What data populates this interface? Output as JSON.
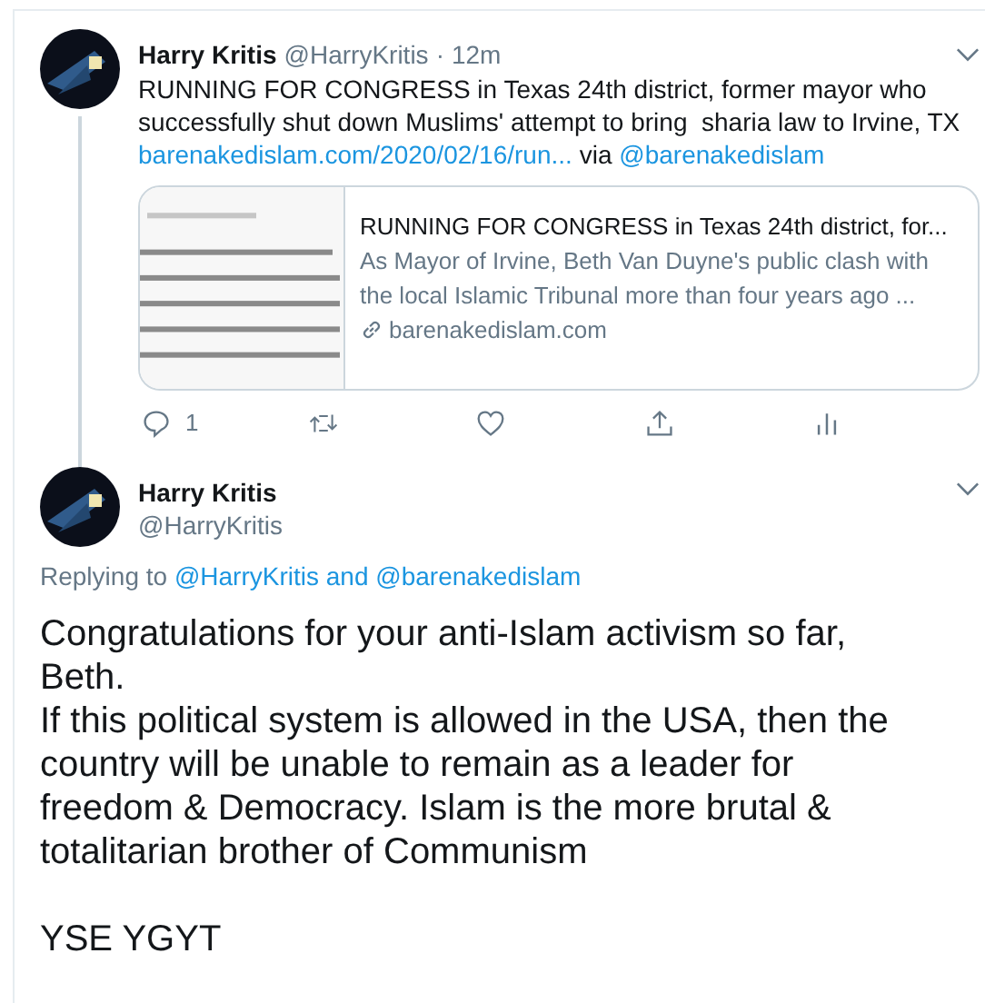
{
  "tweet": {
    "name": "Harry Kritis",
    "handle": "@HarryKritis",
    "dot": "·",
    "time": "12m",
    "text": "RUNNING FOR CONGRESS in Texas 24th district, former mayor who successfully shut down Muslims' attempt to bring  sharia law to Irvine, TX",
    "link": "barenakedislam.com/2020/02/16/run...",
    "via": "via",
    "via_handle": "@barenakedislam",
    "card": {
      "title": "RUNNING FOR CONGRESS in Texas 24th district, for...",
      "description": "As Mayor of Irvine, Beth Van Duyne's public clash with the local Islamic Tribunal more than four years ago ...",
      "domain": "barenakedislam.com"
    },
    "actions": [
      {
        "kind": "reply",
        "count": "1"
      },
      {
        "kind": "retweet"
      },
      {
        "kind": "like"
      },
      {
        "kind": "share"
      },
      {
        "kind": "analytics"
      }
    ]
  },
  "reply": {
    "name": "Harry Kritis",
    "handle": "@HarryKritis",
    "replying_to": "Replying to",
    "mentions": [
      "@HarryKritis",
      "@barenakedislam"
    ],
    "joiner": "and",
    "paragraphs": [
      "Congratulations for your anti-Islam activism so far, Beth.",
      "If this political system is allowed in the USA, then the country will be unable to remain as a leader for freedom & Democracy. Islam is the more brutal & totalitarian brother of Communism",
      "YSE YGYT"
    ]
  }
}
